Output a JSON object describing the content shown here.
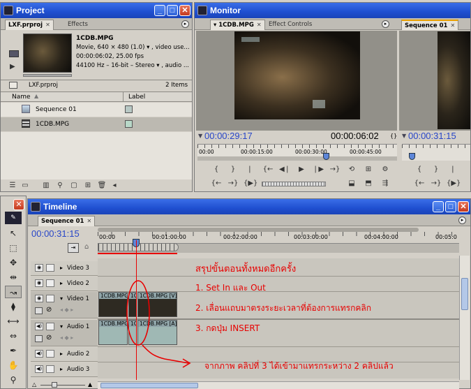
{
  "project": {
    "title": "Project",
    "tabs": [
      "LXF.prproj",
      "Effects"
    ],
    "clip_name": "1CDB.MPG",
    "clip_info": [
      "Movie, 640 × 480 (1.0) ▾ , video use...",
      "00:00:06:02, 25.00 fps",
      "44100 Hz – 16-bit – Stereo ▾ , audio ..."
    ],
    "bin_name": "LXF.prproj",
    "item_count": "2 Items",
    "col_name": "Name",
    "col_label": "Label",
    "items": [
      {
        "name": "Sequence 01",
        "icon": "sequence-icon"
      },
      {
        "name": "1CDB.MPG",
        "icon": "film-icon"
      }
    ]
  },
  "monitor": {
    "title": "Monitor",
    "source_tab": "1CDB.MPG",
    "effect_tab": "Effect Controls",
    "program_tab": "Sequence 01",
    "source_tc": "00:00:29:17",
    "source_duration": "00:00:06:02",
    "program_tc": "00:00:31:15",
    "ruler": [
      "00:00",
      "00:00:15:00",
      "00:00:30:00",
      "00:00:45:00"
    ],
    "source_playhead": 0.64
  },
  "timeline": {
    "title": "Timeline",
    "tab": "Sequence 01",
    "timecode": "00:00:31:15",
    "ruler": [
      "00:00",
      "00:01:00:00",
      "00:02:00:00",
      "00:03:00:00",
      "00:04:00:00",
      "00:05:0"
    ],
    "tracks": [
      "Video 3",
      "Video 2",
      "Video 1",
      "Audio 1",
      "Audio 2",
      "Audio 3"
    ],
    "clips": {
      "v1a": "1CDB.MPG",
      "v1b": "1C",
      "v1c": "1CDB.MPG [V]",
      "a1a": "1CDB.MPG",
      "a1b": "1C",
      "a1c": "1CDB.MPG [A]"
    }
  },
  "annotations": {
    "summary": "สรุปขั้นตอนทั้งหมดอีกครั้ง",
    "step1": "1. Set In และ Out",
    "step2": "2. เลื่อนแถบมาตรงระยะเวลาที่ต้องการแทรกคลิก",
    "step3": "3. กดปุ่ม INSERT",
    "result": "จากภาพ คลิปที่ 3 ได้เข้ามาแทรกระหว่าง 2 คลิปแล้ว"
  },
  "colors": {
    "accent": "#1f4fd0",
    "annotation": "#e80000",
    "timecode": "#2846c8"
  }
}
